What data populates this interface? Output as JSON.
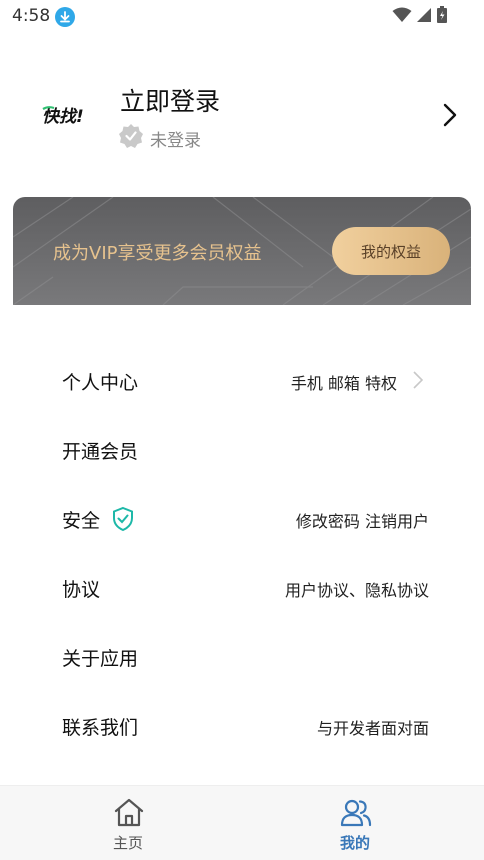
{
  "status_bar": {
    "time": "4:58"
  },
  "profile": {
    "logo_text": "快找!",
    "name": "立即登录",
    "status": "未登录"
  },
  "vip": {
    "text": "成为VIP享受更多会员权益",
    "button_label": "我的权益",
    "colors": {
      "banner": "#6b6b6d",
      "text": "#e6c28e",
      "button": "#e6c28e"
    }
  },
  "menu": {
    "items": [
      {
        "label": "个人中心",
        "value": "手机 邮箱 特权"
      },
      {
        "label": "开通会员",
        "value": ""
      },
      {
        "label": "安全",
        "value": "修改密码  注销用户"
      },
      {
        "label": "协议",
        "value": "用户协议、隐私协议"
      },
      {
        "label": "关于应用",
        "value": ""
      },
      {
        "label": "联系我们",
        "value": "与开发者面对面"
      }
    ]
  },
  "tab_bar": {
    "tabs": [
      {
        "label": "主页",
        "icon": "home-icon",
        "active": false
      },
      {
        "label": "我的",
        "icon": "users-icon",
        "active": true
      }
    ],
    "active_color": "#3a78b8"
  }
}
